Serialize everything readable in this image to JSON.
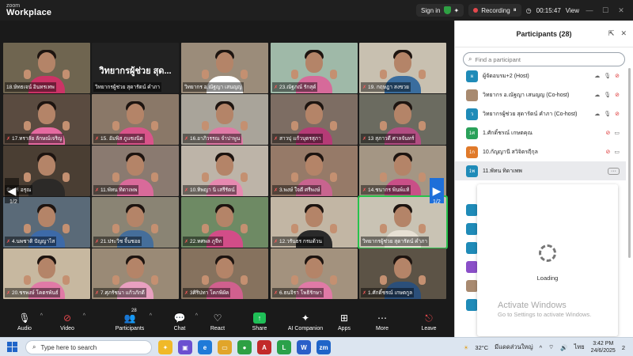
{
  "app": {
    "logo_line1": "zoom",
    "logo_line2": "Workplace"
  },
  "topbar": {
    "sign_in": "Sign in",
    "recording": "Recording",
    "timer": "00:15:47",
    "view": "View"
  },
  "grid": {
    "tiles": [
      {
        "caption": "18.ษัทธเจน์ อินทรเทพ",
        "muted": false,
        "kind": "person",
        "bg": "#6f6550",
        "shirt": "#cc3366"
      },
      {
        "caption": "วิทยากรผู้ช่วย สุดารัตน์ คำภา",
        "bigname": "วิทยากรผู้ช่วย สุด...",
        "muted": false,
        "kind": "name",
        "bg": "#222222",
        "shirt": "#000000"
      },
      {
        "caption": "วิทยากร อ.ณัฐญา เสนญญ",
        "muted": false,
        "kind": "person",
        "bg": "#9b8c7a",
        "shirt": "#ffffff"
      },
      {
        "caption": "23.ณัฐภณ์ รักสุด์",
        "muted": true,
        "kind": "person",
        "bg": "#9fb9a8",
        "shirt": "#d66a9a"
      },
      {
        "caption": "19. กฤษฎา สงขวย",
        "muted": true,
        "kind": "person",
        "bg": "#c8c0b0",
        "shirt": "#3a6d9e"
      },
      {
        "caption": "17.ทราลัย ลักษณ์เจริญ",
        "muted": true,
        "kind": "person",
        "bg": "#5a4b40",
        "shirt": "#e56aa0"
      },
      {
        "caption": "15. อัมพิส ภูแซงนิต",
        "muted": true,
        "kind": "person",
        "bg": "#8a7868",
        "shirt": "#d9548a"
      },
      {
        "caption": "16.อาภิวรรณ จำปาพูน",
        "muted": true,
        "kind": "person",
        "bg": "#a9a49a",
        "shirt": "#e07aa6"
      },
      {
        "caption": "สาวปุ แก้วบุตรสุภา",
        "muted": true,
        "kind": "person",
        "bg": "#7d6d63",
        "shirt": "#b53b76"
      },
      {
        "caption": "13 สุภาวดี ศาลจันทร์",
        "muted": true,
        "kind": "person",
        "bg": "#6b6b60",
        "shirt": "#b24d82"
      },
      {
        "caption": "จันทร์ อรุณ",
        "muted": false,
        "kind": "person",
        "bg": "#4a3e33",
        "shirt": "#2c2a28"
      },
      {
        "caption": "11.พัทน ทิดาเพพ",
        "muted": true,
        "kind": "person",
        "bg": "#8a7a70",
        "shirt": "#d96a9a"
      },
      {
        "caption": "10.ทิพญา นิ เสรีรัตน์",
        "muted": true,
        "kind": "person",
        "bg": "#bdb4a8",
        "shirt": "#e789b0"
      },
      {
        "caption": "3.พงษ์ ใจดี ศรีพงษ์",
        "muted": true,
        "kind": "person",
        "bg": "#967a68",
        "shirt": "#c8648f"
      },
      {
        "caption": "14.ชนากร พินพ์แท้",
        "muted": true,
        "kind": "person",
        "bg": "#a49684",
        "shirt": "#c94f87"
      },
      {
        "caption": "4.นพชาติ ปัญญาไส",
        "muted": true,
        "kind": "person",
        "bg": "#5a6a78",
        "shirt": "#3d6aa8"
      },
      {
        "caption": "21.ประวิช จิ้นชอย",
        "muted": true,
        "kind": "person",
        "bg": "#8a8474",
        "shirt": "#456e9a"
      },
      {
        "caption": "22.ทศพล ภูจีท",
        "muted": true,
        "kind": "person",
        "bg": "#6e8a64",
        "shirt": "#d24d88"
      },
      {
        "caption": "12.วรันธร กรมด้วน",
        "muted": true,
        "kind": "person",
        "bg": "#c2b6a4",
        "shirt": "#2a2a2a"
      },
      {
        "caption": "วิทยากรผู้ช่วย สุดารัตน์ คำภา",
        "muted": false,
        "kind": "person",
        "bg": "#c9c3b4",
        "shirt": "#e7e0d4",
        "active": true
      },
      {
        "caption": "20.ชรพงษ์ โคตรพันธ์",
        "muted": true,
        "kind": "person",
        "bg": "#c7b8a0",
        "shirt": "#e07aa6"
      },
      {
        "caption": "7.ศุภรัชนา แก้วภักดี",
        "muted": true,
        "kind": "person",
        "bg": "#9a8a76",
        "shirt": "#e8a0c0"
      },
      {
        "caption": "3ศิริปทา โคกพิผัค",
        "muted": true,
        "kind": "person",
        "bg": "#86725e",
        "shirt": "#d0608e"
      },
      {
        "caption": "6.ธนจิรา โพธิรักษา",
        "muted": true,
        "kind": "person",
        "bg": "#a3927e",
        "shirt": "#e07aa6"
      },
      {
        "caption": "1.ศักดิ์ชรณ์ เกษตกูล",
        "muted": true,
        "kind": "person",
        "bg": "#5c5346",
        "shirt": "#2b4f7a"
      }
    ],
    "page_left": "1/2",
    "page_right": "1/2"
  },
  "panel": {
    "title": "Participants (28)",
    "search_placeholder": "Find a participant",
    "participants": [
      {
        "initials": "ผ",
        "name": "ผู้จัดอบรม+2 (Host)",
        "color": "#1f8bb8"
      },
      {
        "initials": "",
        "name": "วิทยากร อ.ณัฐญา เสนญญ (Co-host)",
        "color": "#a88a70"
      },
      {
        "initials": "ว",
        "name": "วิทยากรผู้ช่วย สุดารัตน์ คำภา (Co-host)",
        "color": "#1f8bb8"
      },
      {
        "initials": "1ศ",
        "name": "1.ศักดิ์ชรณ์ เกษตคุณ",
        "color": "#2aa15a"
      },
      {
        "initials": "1ก",
        "name": "10.กัญญานี สวิจิตรฤีกุล",
        "color": "#e07a2a"
      },
      {
        "initials": "1พ",
        "name": "11.พัทน ทิดาเพพ",
        "color": "#1f8bb8"
      }
    ],
    "loading": "Loading",
    "more_button": "···"
  },
  "watermark": {
    "line1": "Activate Windows",
    "line2": "Go to Settings to activate Windows."
  },
  "toolbar": {
    "audio": "Audio",
    "video": "Video",
    "participants": "Participants",
    "participants_count": "28",
    "chat": "Chat",
    "react": "React",
    "share": "Share",
    "ai": "AI Companion",
    "apps": "Apps",
    "more": "More",
    "leave": "Leave"
  },
  "taskbar": {
    "search_placeholder": "Type here to search",
    "temp": "32°C",
    "weather": "มีแดดส่วนใหญ่",
    "lang": "ไทย",
    "time": "3:42 PM",
    "date": "24/6/2025",
    "notif": "2"
  }
}
